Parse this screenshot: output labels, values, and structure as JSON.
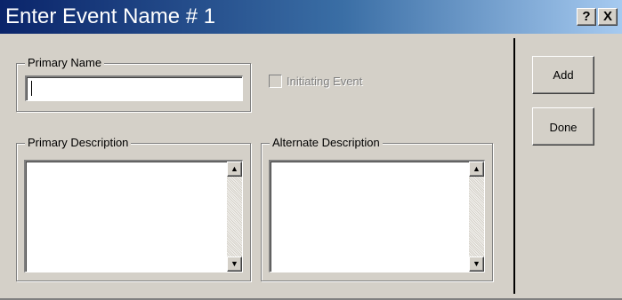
{
  "window": {
    "title": "Enter Event Name # 1",
    "help_label": "?",
    "close_label": "X",
    "title_gradient": [
      "#0a246a",
      "#a6caf0"
    ]
  },
  "primary_name": {
    "legend": "Primary Name",
    "value": ""
  },
  "initiating_event": {
    "label": "Initiating Event",
    "checked": false,
    "enabled": false
  },
  "primary_description": {
    "legend": "Primary Description",
    "value": ""
  },
  "alternate_description": {
    "legend": "Alternate Description",
    "value": ""
  },
  "scroll_icons": {
    "up": "▲",
    "down": "▼"
  },
  "buttons": {
    "add": "Add",
    "done": "Done"
  }
}
